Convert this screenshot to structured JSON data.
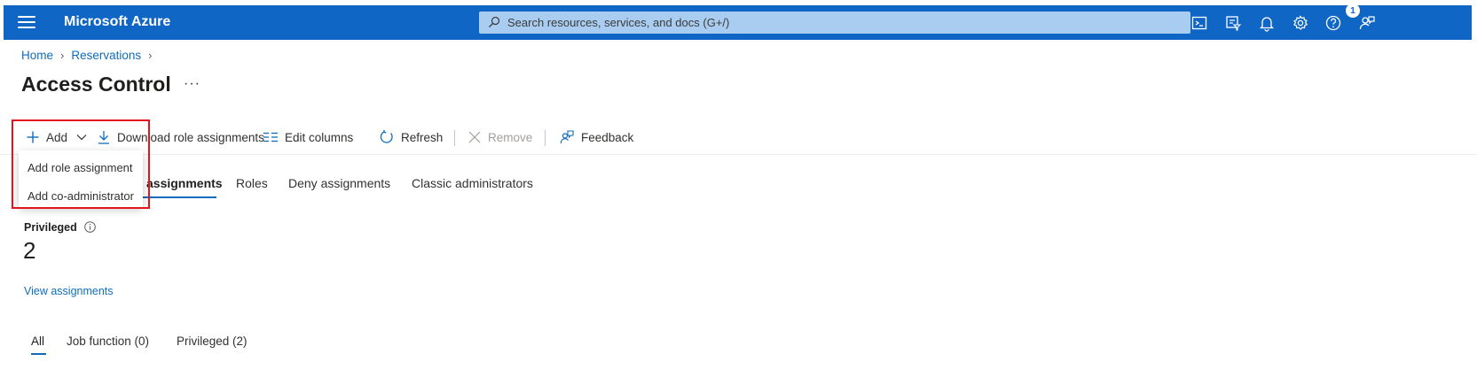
{
  "header": {
    "brand": "Microsoft Azure",
    "search_placeholder": "Search resources, services, and docs (G+/)",
    "notification_count": "1",
    "icons": [
      "cloud-shell-icon",
      "directory-filter-icon",
      "notifications-icon",
      "settings-icon",
      "help-icon",
      "feedback-icon"
    ]
  },
  "breadcrumb": {
    "items": [
      "Home",
      "Reservations"
    ]
  },
  "page": {
    "title": "Access Control",
    "more": "···"
  },
  "command_bar": {
    "add": "Add",
    "download": "Download role assignments",
    "edit_columns": "Edit columns",
    "refresh": "Refresh",
    "remove": "Remove",
    "feedback": "Feedback"
  },
  "add_dropdown": {
    "items": [
      "Add role assignment",
      "Add co-administrator"
    ]
  },
  "tabs": {
    "role_assignments": "assignments",
    "roles": "Roles",
    "deny_assignments": "Deny assignments",
    "classic_administrators": "Classic administrators"
  },
  "privileged": {
    "label": "Privileged",
    "count": "2",
    "link": "View assignments"
  },
  "filter_tabs": {
    "all": "All",
    "job_function": "Job function (0)",
    "privileged": "Privileged (2)"
  },
  "colors": {
    "header_bg": "#1066c5",
    "accent": "#0f6cbd",
    "highlight": "#e3141c"
  }
}
